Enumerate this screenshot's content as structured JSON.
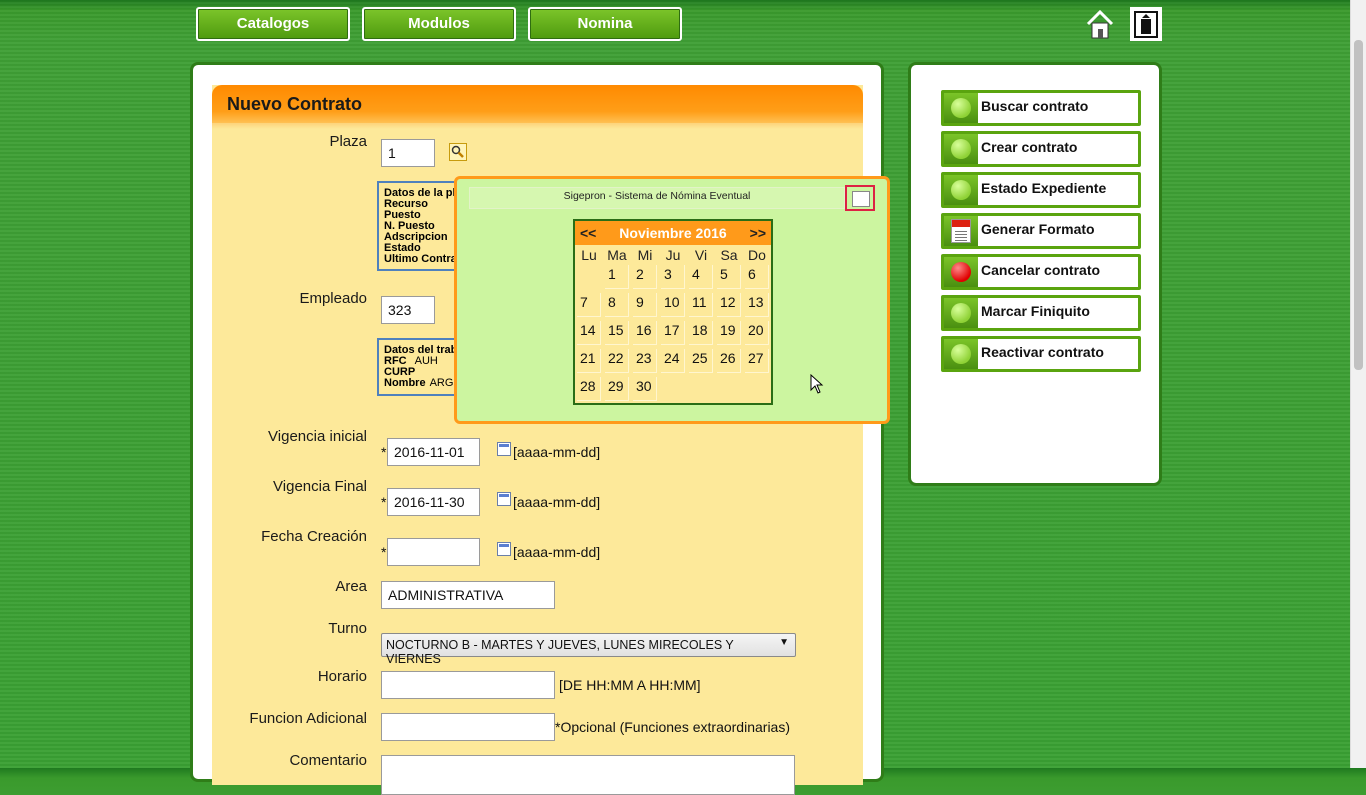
{
  "nav": {
    "items": [
      "Catalogos",
      "Modulos",
      "Nomina"
    ]
  },
  "icons": {
    "home": "home-icon",
    "exit": "exit-icon"
  },
  "form": {
    "title": "Nuevo Contrato",
    "plaza": {
      "label": "Plaza",
      "value": "1"
    },
    "plaza_info": {
      "heading": "Datos de la pl",
      "rows": [
        "Recurso",
        "Puesto",
        "N. Puesto",
        "Adscripcion",
        "Estado",
        "Ultimo Contra"
      ]
    },
    "empleado": {
      "label": "Empleado",
      "value": "323"
    },
    "empleado_info": {
      "heading": "Datos del trab",
      "rfc_label": "RFC",
      "rfc_value": "AUH",
      "curp_label": "CURP",
      "nombre_label": "Nombre",
      "nombre_value": "ARG"
    },
    "vigencia_inicial": {
      "label": "Vigencia inicial",
      "value": "2016-11-01",
      "hint": "[aaaa-mm-dd]"
    },
    "vigencia_final": {
      "label": "Vigencia Final",
      "value": "2016-11-30",
      "hint": "[aaaa-mm-dd]"
    },
    "fecha_creacion": {
      "label": "Fecha Creación",
      "value": "",
      "hint": "[aaaa-mm-dd]"
    },
    "area": {
      "label": "Area",
      "value": "ADMINISTRATIVA"
    },
    "turno": {
      "label": "Turno",
      "value": "NOCTURNO B - MARTES Y JUEVES, LUNES MIRECOLES Y VIERNES"
    },
    "horario": {
      "label": "Horario",
      "value": "",
      "hint": "[DE HH:MM A HH:MM]"
    },
    "funcion": {
      "label": "Funcion Adicional",
      "value": "",
      "hint": "*Opcional (Funciones extraordinarias)"
    },
    "comentario": {
      "label": "Comentario"
    },
    "required_mark": "*"
  },
  "side": {
    "buttons": [
      {
        "label": "Buscar contrato",
        "icon": "green-dot-icon"
      },
      {
        "label": "Crear contrato",
        "icon": "green-dot-icon"
      },
      {
        "label": "Estado Expediente",
        "icon": "green-dot-icon"
      },
      {
        "label": "Generar Formato",
        "icon": "pdf-icon"
      },
      {
        "label": "Cancelar contrato",
        "icon": "red-dot-icon"
      },
      {
        "label": "Marcar Finiquito",
        "icon": "green-dot-icon"
      },
      {
        "label": "Reactivar contrato",
        "icon": "green-dot-icon"
      }
    ]
  },
  "calendar": {
    "window_title": "Sigepron - Sistema de Nómina Eventual",
    "prev": "<<",
    "next": ">>",
    "month_label": "Noviembre 2016",
    "weekdays": [
      "Lu",
      "Ma",
      "Mi",
      "Ju",
      "Vi",
      "Sa",
      "Do"
    ],
    "first_weekday_index": 1,
    "days_in_month": 30
  },
  "colors": {
    "accent_orange": "#ff9a1a",
    "nav_green": "#5aa40f",
    "form_bg": "#fde99a",
    "popup_bg": "#ccf5a0"
  }
}
